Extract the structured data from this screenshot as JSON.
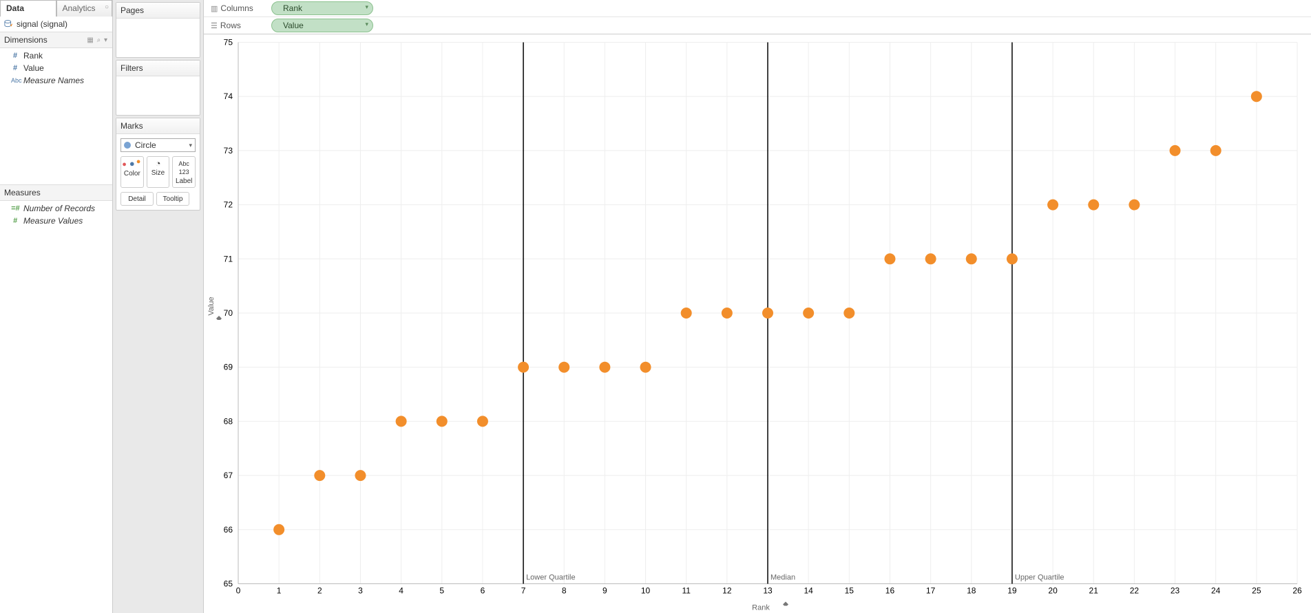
{
  "tabs": {
    "data": "Data",
    "analytics": "Analytics"
  },
  "datasource": {
    "name": "signal (signal)"
  },
  "dimensions": {
    "heading": "Dimensions",
    "fields": [
      {
        "icon": "#",
        "label": "Rank"
      },
      {
        "icon": "#",
        "label": "Value"
      },
      {
        "icon": "Abc",
        "label": "Measure Names",
        "italic": true
      }
    ]
  },
  "measures": {
    "heading": "Measures",
    "fields": [
      {
        "icon": "=#",
        "label": "Number of Records",
        "italic": true
      },
      {
        "icon": "#",
        "label": "Measure Values",
        "italic": true
      }
    ]
  },
  "cards": {
    "pages": "Pages",
    "filters": "Filters",
    "marks": "Marks",
    "marks_type": "Circle",
    "props": {
      "color": "Color",
      "size": "Size",
      "label": "Label",
      "detail": "Detail",
      "tooltip": "Tooltip"
    }
  },
  "shelf": {
    "columns": "Columns",
    "rows": "Rows",
    "columns_pill": "Rank",
    "rows_pill": "Value"
  },
  "chart_data": {
    "type": "scatter",
    "xlabel": "Rank",
    "ylabel": "Value",
    "xlim": [
      0,
      26
    ],
    "ylim": [
      65,
      75
    ],
    "xticks": [
      0,
      1,
      2,
      3,
      4,
      5,
      6,
      7,
      8,
      9,
      10,
      11,
      12,
      13,
      14,
      15,
      16,
      17,
      18,
      19,
      20,
      21,
      22,
      23,
      24,
      25,
      26
    ],
    "yticks": [
      65,
      66,
      67,
      68,
      69,
      70,
      71,
      72,
      73,
      74,
      75
    ],
    "reference_lines": [
      {
        "x": 7,
        "label": "Lower Quartile"
      },
      {
        "x": 13,
        "label": "Median"
      },
      {
        "x": 19,
        "label": "Upper Quartile"
      }
    ],
    "points": [
      {
        "x": 1,
        "y": 66
      },
      {
        "x": 2,
        "y": 67
      },
      {
        "x": 3,
        "y": 67
      },
      {
        "x": 4,
        "y": 68
      },
      {
        "x": 5,
        "y": 68
      },
      {
        "x": 6,
        "y": 68
      },
      {
        "x": 7,
        "y": 69
      },
      {
        "x": 8,
        "y": 69
      },
      {
        "x": 9,
        "y": 69
      },
      {
        "x": 10,
        "y": 69
      },
      {
        "x": 11,
        "y": 70
      },
      {
        "x": 12,
        "y": 70
      },
      {
        "x": 13,
        "y": 70
      },
      {
        "x": 14,
        "y": 70
      },
      {
        "x": 15,
        "y": 70
      },
      {
        "x": 16,
        "y": 71
      },
      {
        "x": 17,
        "y": 71
      },
      {
        "x": 18,
        "y": 71
      },
      {
        "x": 19,
        "y": 71
      },
      {
        "x": 20,
        "y": 72
      },
      {
        "x": 21,
        "y": 72
      },
      {
        "x": 22,
        "y": 72
      },
      {
        "x": 23,
        "y": 73
      },
      {
        "x": 24,
        "y": 73
      },
      {
        "x": 25,
        "y": 74
      }
    ]
  }
}
